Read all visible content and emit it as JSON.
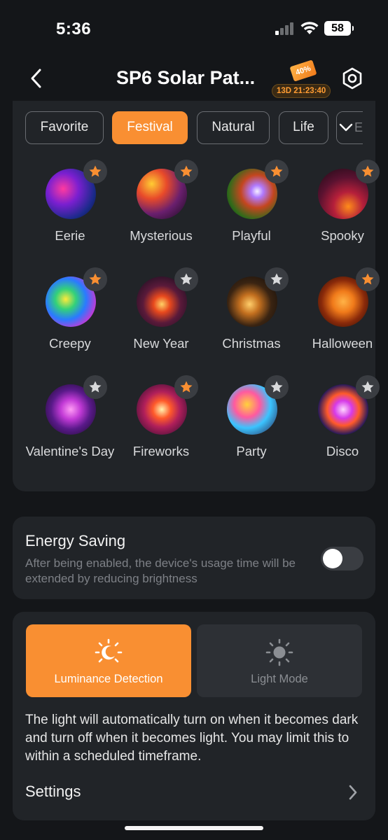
{
  "status_bar": {
    "time": "5:36",
    "battery": "58"
  },
  "header": {
    "title": "SP6 Solar Pat...",
    "promo_badge": "40%",
    "promo_timer": "13D 21:23:40"
  },
  "tabs": [
    {
      "label": "Favorite",
      "active": false
    },
    {
      "label": "Festival",
      "active": true
    },
    {
      "label": "Natural",
      "active": false
    },
    {
      "label": "Life",
      "active": false
    }
  ],
  "tabs_overflow_label": "E",
  "scenes": [
    {
      "label": "Eerie",
      "favorite": true
    },
    {
      "label": "Mysterious",
      "favorite": true
    },
    {
      "label": "Playful",
      "favorite": true
    },
    {
      "label": "Spooky",
      "favorite": true
    },
    {
      "label": "Creepy",
      "favorite": true
    },
    {
      "label": "New Year",
      "favorite": false
    },
    {
      "label": "Christmas",
      "favorite": false
    },
    {
      "label": "Halloween",
      "favorite": true
    },
    {
      "label": "Valentine's Day",
      "favorite": false
    },
    {
      "label": "Fireworks",
      "favorite": true
    },
    {
      "label": "Party",
      "favorite": false
    },
    {
      "label": "Disco",
      "favorite": false
    }
  ],
  "energy_saving": {
    "title": "Energy Saving",
    "description": "After being enabled, the device's usage time will be extended by reducing brightness",
    "enabled": false
  },
  "modes": {
    "luminance_label": "Luminance Detection",
    "light_mode_label": "Light Mode",
    "description": "The light will automatically turn on when it becomes dark and turn off when it becomes light. You may limit this to within a scheduled timeframe.",
    "settings_label": "Settings"
  },
  "colors": {
    "accent": "#f98f32",
    "background": "#141619",
    "card": "#212428"
  },
  "icons": {
    "back": "chevron-left-icon",
    "settings": "gear-icon",
    "favorite": "star-icon",
    "luminance": "moon-sun-icon",
    "light_mode": "sun-icon",
    "chevron": "chevron-right-icon"
  }
}
